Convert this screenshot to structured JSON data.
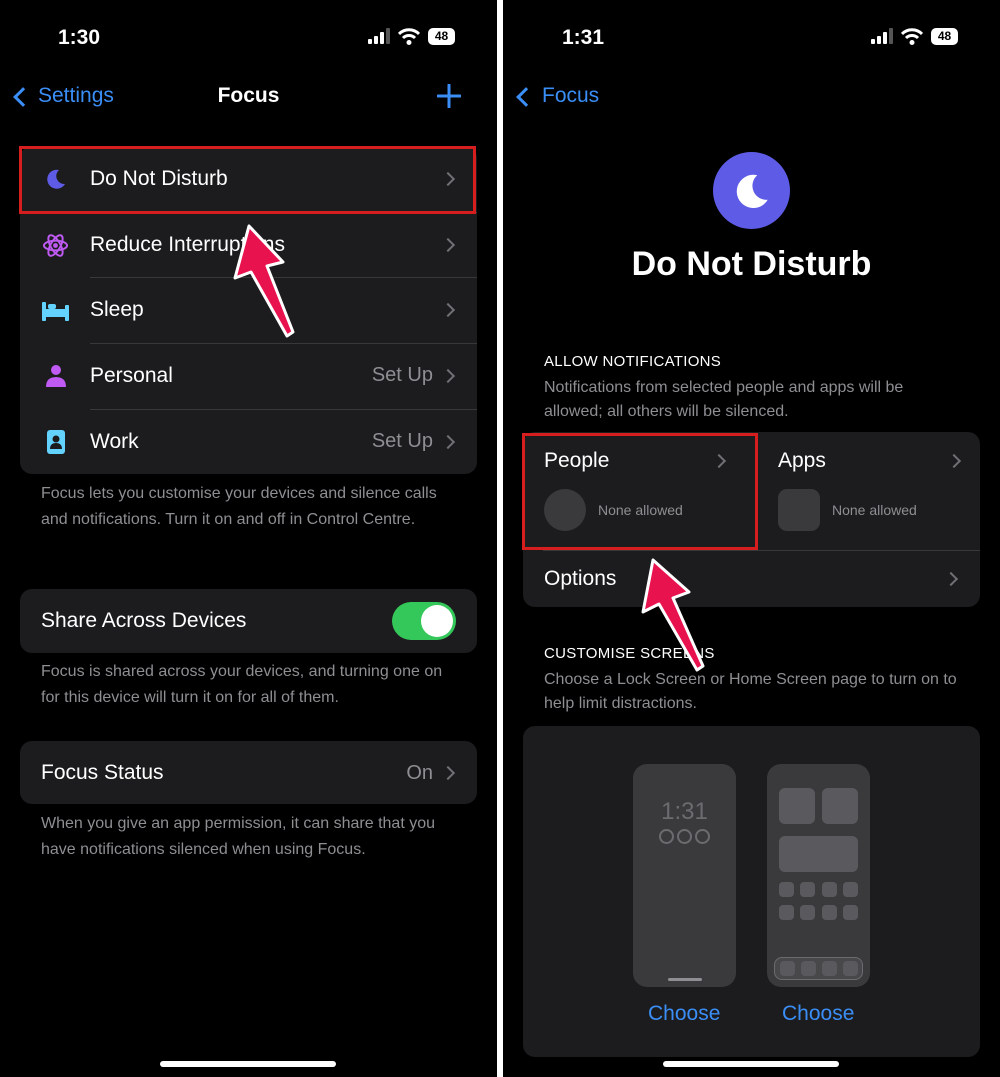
{
  "left": {
    "status": {
      "time": "1:30",
      "battery": "48"
    },
    "nav": {
      "back_label": "Settings",
      "title": "Focus"
    },
    "focus_modes": [
      {
        "label": "Do Not Disturb",
        "value": "",
        "icon": "moon-icon"
      },
      {
        "label": "Reduce Interruptions",
        "value": "",
        "icon": "atom-icon"
      },
      {
        "label": "Sleep",
        "value": "",
        "icon": "bed-icon"
      },
      {
        "label": "Personal",
        "value": "Set Up",
        "icon": "person-icon"
      },
      {
        "label": "Work",
        "value": "Set Up",
        "icon": "badge-icon"
      }
    ],
    "focus_footer": "Focus lets you customise your devices and silence calls and notifications. Turn it on and off in Control Centre.",
    "share": {
      "label": "Share Across Devices",
      "on": true
    },
    "share_footer": "Focus is shared across your devices, and turning one on for this device will turn it on for all of them.",
    "status_row": {
      "label": "Focus Status",
      "value": "On"
    },
    "status_footer": "When you give an app permission, it can share that you have notifications silenced when using Focus."
  },
  "right": {
    "status": {
      "time": "1:31",
      "battery": "48"
    },
    "nav": {
      "back_label": "Focus"
    },
    "title": "Do Not Disturb",
    "allow": {
      "heading": "ALLOW NOTIFICATIONS",
      "description": "Notifications from selected people and apps will be allowed; all others will be silenced.",
      "people": {
        "label": "People",
        "status": "None allowed"
      },
      "apps": {
        "label": "Apps",
        "status": "None allowed"
      },
      "options_label": "Options"
    },
    "customise": {
      "heading": "CUSTOMISE SCREENS",
      "description": "Choose a Lock Screen or Home Screen page to turn on to help limit distractions.",
      "lock_time": "1:31",
      "choose_lock": "Choose",
      "choose_home": "Choose"
    }
  },
  "colors": {
    "accent": "#3a8ef6",
    "highlight": "#d71e1e",
    "arrow": "#e8124f",
    "toggle_on": "#34c759",
    "dnd": "#5e5ce6"
  }
}
